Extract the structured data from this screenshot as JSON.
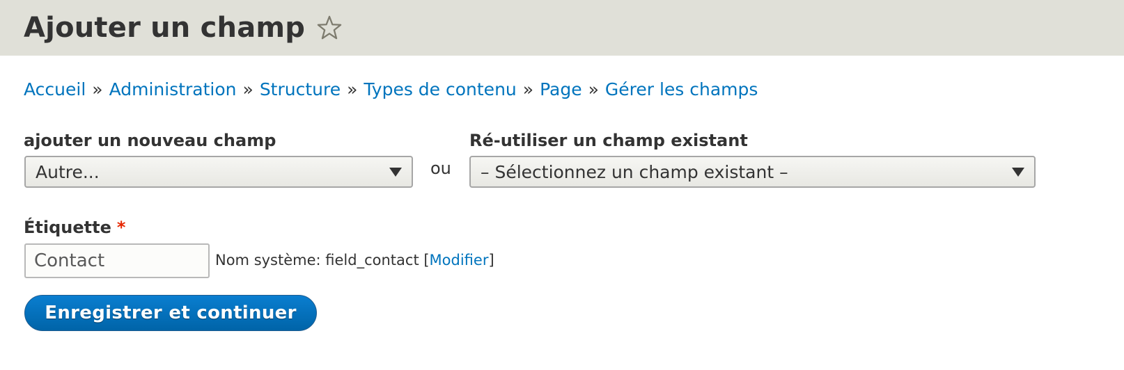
{
  "header": {
    "title": "Ajouter un champ",
    "shortcut_icon": "star-outline-icon"
  },
  "breadcrumb": {
    "items": [
      "Accueil",
      "Administration",
      "Structure",
      "Types de contenu",
      "Page",
      "Gérer les champs"
    ],
    "separator": "»"
  },
  "form": {
    "new_field": {
      "label": "ajouter un nouveau champ",
      "selected": "Autre..."
    },
    "or_text": "ou",
    "existing_field": {
      "label": "Ré-utiliser un champ existant",
      "selected": "– Sélectionnez un champ existant –"
    },
    "label_field": {
      "label": "Étiquette",
      "required_marker": "*",
      "value": "Contact"
    },
    "machine_name": {
      "prefix": "Nom système: field_contact [",
      "edit_link": "Modifier",
      "suffix": "]"
    },
    "submit_label": "Enregistrer et continuer"
  },
  "colors": {
    "header_bg": "#e0e0d8",
    "link": "#0074bd",
    "primary_button": "#0074bd",
    "required": "#e62600"
  }
}
